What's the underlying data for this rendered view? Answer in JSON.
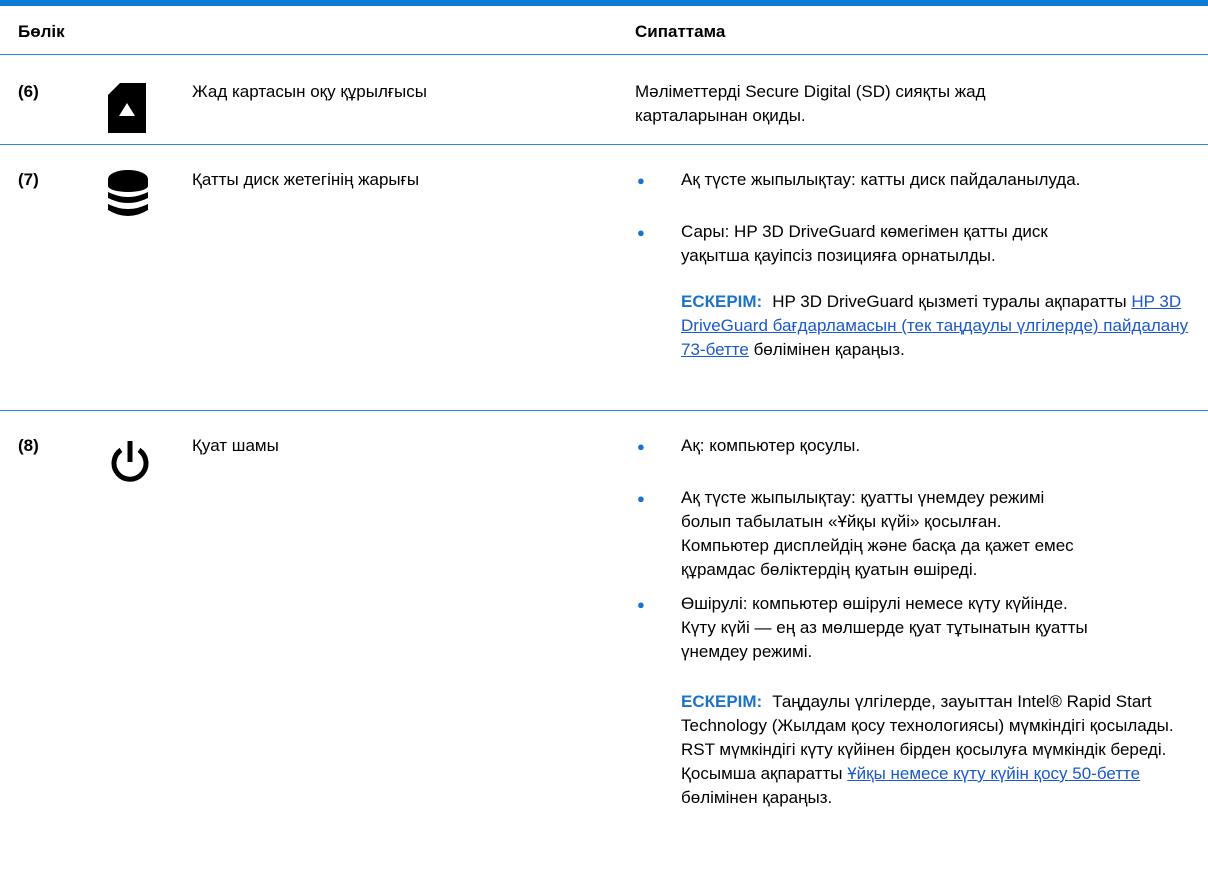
{
  "header": {
    "col_part": "Бөлік",
    "col_desc": "Сипаттама"
  },
  "rows": [
    {
      "num": "(6)",
      "icon": "sd-card-icon",
      "name": "Жад картасын оқу құрылғысы",
      "desc_lines": [
        "Мәліметтерді Secure Digital (SD) сияқты жад",
        "карталарынан оқиды."
      ]
    },
    {
      "num": "(7)",
      "icon": "hard-drive-stack-icon",
      "name": "Қатты диск жетегінің жарығы",
      "bullets": [
        {
          "lines": [
            "Ақ түсте жыпылықтау: катты диск пайдаланылуда."
          ]
        },
        {
          "lines": [
            "Сары: HP 3D DriveGuard көмегімен қатты диск",
            "уақытша қауіпсіз позицияға орнатылды."
          ]
        }
      ],
      "note": {
        "label": "ЕСКЕРІМ:",
        "text_before": "HP 3D DriveGuard қызметі туралы ақпаратты ",
        "link": "HP 3D DriveGuard бағдарламасын (тек таңдаулы үлгілерде) пайдалану 73-бетте",
        "text_after": " бөлімінен қараңыз."
      }
    },
    {
      "num": "(8)",
      "icon": "power-icon",
      "name": "Қуат шамы",
      "bullets": [
        {
          "lines": [
            "Ақ: компьютер қосулы."
          ]
        },
        {
          "lines": [
            "Ақ түсте жыпылықтау: қуатты үнемдеу режимі",
            "болып табылатын «Ұйқы күйі» қосылған.",
            "Компьютер дисплейдің және басқа да қажет емес",
            "құрамдас бөліктердің қуатын өшіреді."
          ]
        },
        {
          "lines": [
            "Өшірулі: компьютер өшірулі немесе күту күйінде.",
            "Күту күйі — ең аз мөлшерде қуат тұтынатын қуатты",
            "үнемдеу режимі."
          ]
        }
      ],
      "note": {
        "label": "ЕСКЕРІМ:",
        "text_before": "Таңдаулы үлгілерде, зауыттан Intel® Rapid Start Technology (Жылдам қосу технологиясы) мүмкіндігі қосылады. RST мүмкіндігі күту күйінен бірден қосылуға мүмкіндік береді. Қосымша ақпаратты ",
        "link": "Ұйқы немесе күту күйін қосу 50-бетте",
        "text_after": " бөлімінен қараңыз."
      }
    }
  ],
  "colors": {
    "accent": "#0a7bd6",
    "link": "#1a58cc",
    "note_label": "#1a73c9"
  }
}
